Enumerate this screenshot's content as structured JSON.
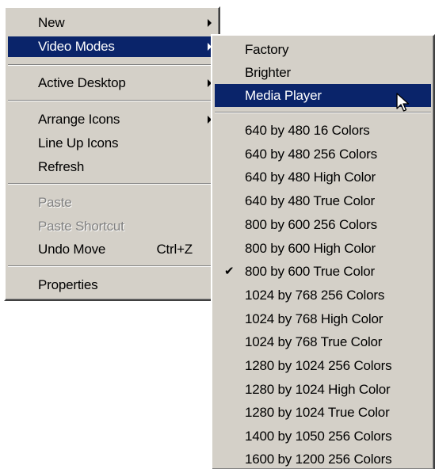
{
  "main_menu": {
    "new": "New",
    "video_modes": "Video Modes",
    "active_desktop": "Active Desktop",
    "arrange_icons": "Arrange Icons",
    "line_up_icons": "Line Up Icons",
    "refresh": "Refresh",
    "paste": "Paste",
    "paste_shortcut": "Paste Shortcut",
    "undo_move": "Undo Move",
    "undo_shortcut": "Ctrl+Z",
    "properties": "Properties"
  },
  "submenu": {
    "items": [
      "Factory",
      "Brighter",
      "Media Player",
      "640 by 480 16 Colors",
      "640 by 480 256 Colors",
      "640 by 480 High Color",
      "640 by 480 True Color",
      "800 by 600 256 Colors",
      "800 by 600 High Color",
      "800 by 600 True Color",
      "1024 by 768 256 Colors",
      "1024 by 768 High Color",
      "1024 by 768 True Color",
      "1280 by 1024 256 Colors",
      "1280 by 1024 High Color",
      "1280 by 1024 True Color",
      "1400 by 1050 256 Colors",
      "1600 by 1200 256 Colors"
    ],
    "highlighted": "Media Player",
    "checked": "800 by 600 True Color"
  },
  "colors": {
    "menu_bg": "#d4d0c8",
    "highlight": "#0a246a",
    "disabled": "#808080"
  },
  "icons": {
    "submenu_arrow": "triangle-right-icon",
    "check": "checkmark-icon",
    "cursor": "mouse-pointer-icon"
  }
}
